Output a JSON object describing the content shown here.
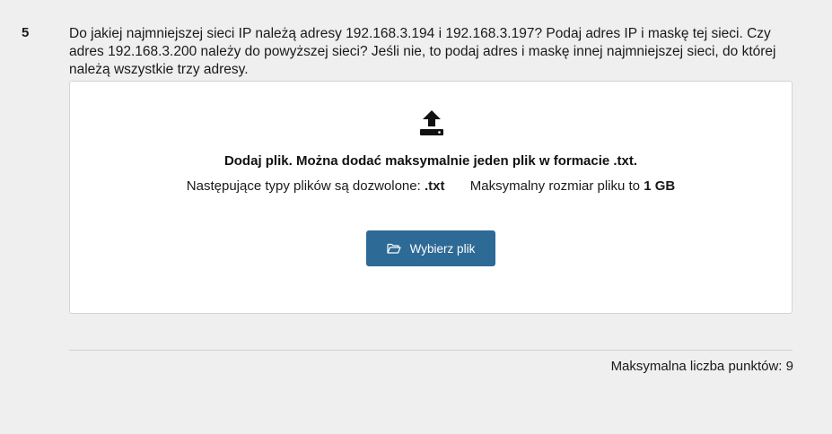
{
  "question": {
    "number": "5",
    "text": "Do jakiej najmniejszej sieci IP należą adresy 192.168.3.194 i 192.168.3.197? Podaj adres IP i maskę tej sieci. Czy adres 192.168.3.200 należy do powyższej sieci? Jeśli nie, to podaj adres i maskę innej najmniejszej sieci, do której należą wszystkie trzy adresy."
  },
  "upload": {
    "icon": "upload-icon",
    "title": "Dodaj plik. Można dodać maksymalnie jeden plik w formacie .txt.",
    "allowed_types_label": "Następujące typy plików są dozwolone:",
    "allowed_types_value": ".txt",
    "max_size_label": "Maksymalny rozmiar pliku to",
    "max_size_value": "1 GB",
    "button_label": "Wybierz plik",
    "button_icon": "folder-open-icon",
    "button_color": "#2d6a96"
  },
  "footer": {
    "max_points": "Maksymalna liczba punktów: 9"
  }
}
